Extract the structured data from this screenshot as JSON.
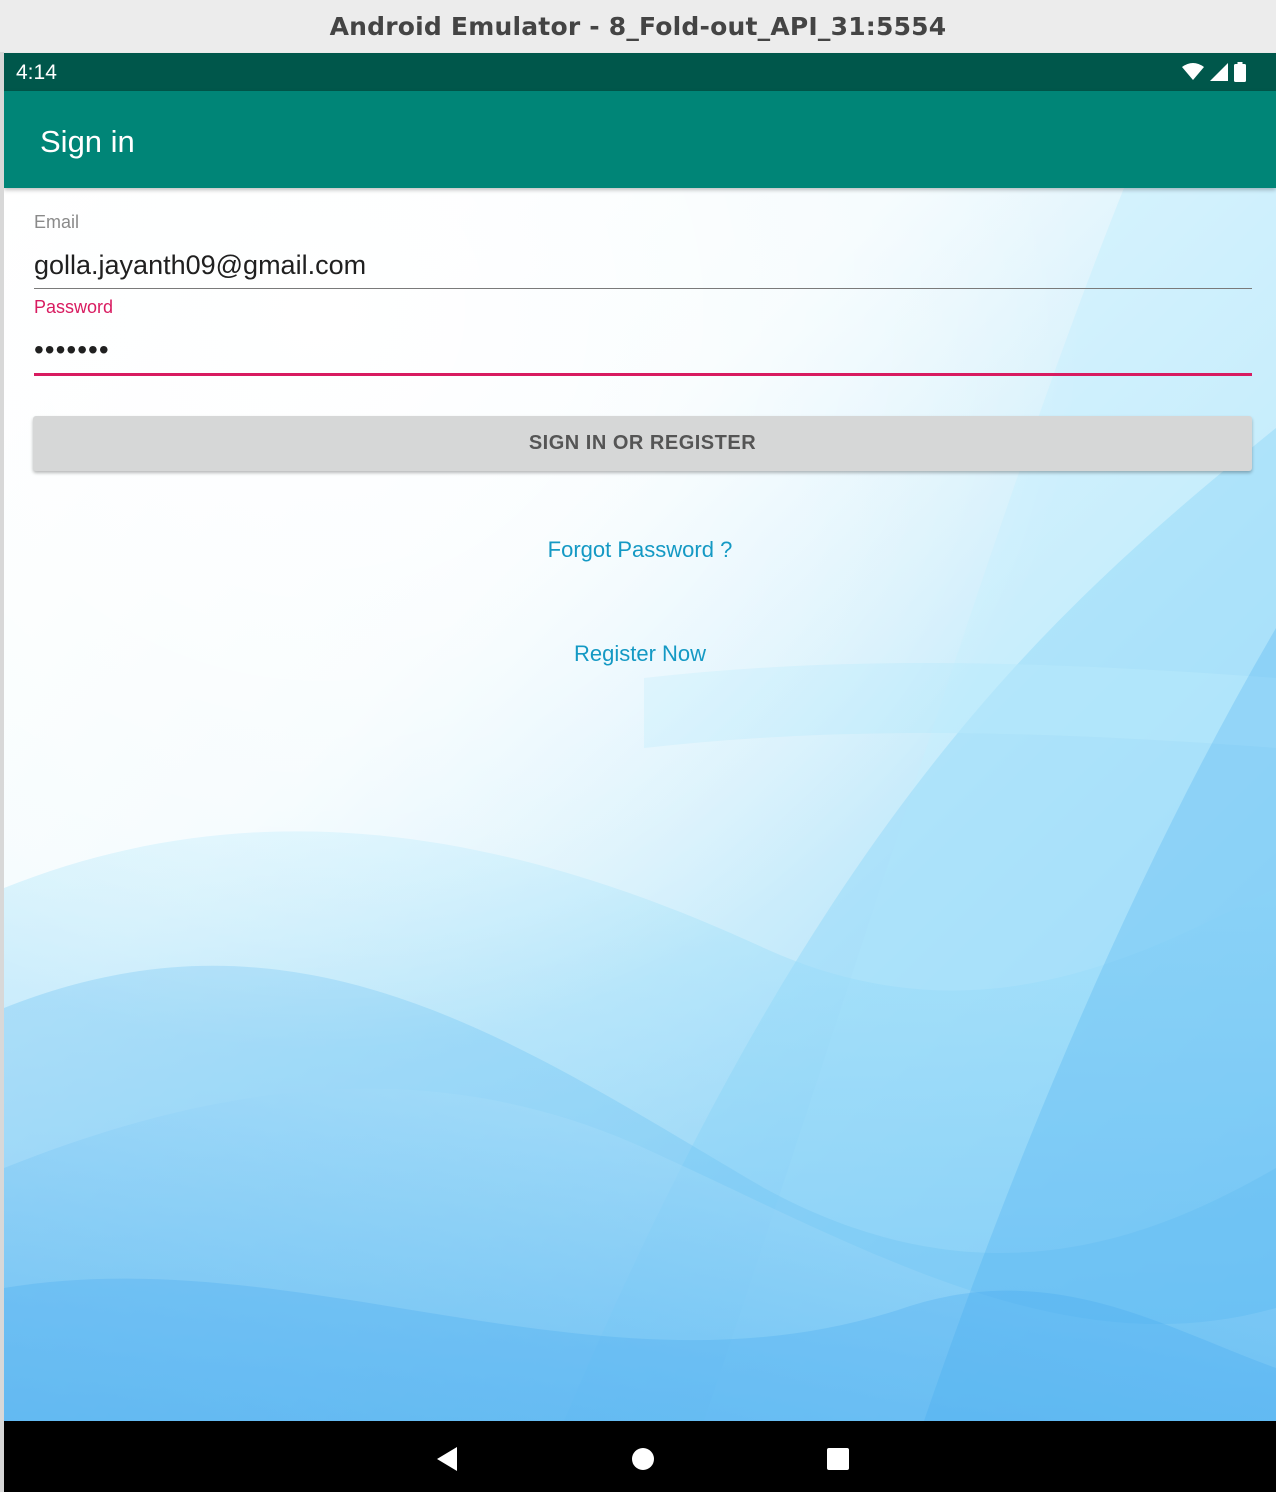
{
  "window": {
    "title": "Android Emulator - 8_Fold-out_API_31:5554"
  },
  "statusbar": {
    "time": "4:14",
    "icons": [
      "wifi-icon",
      "signal-icon",
      "battery-icon"
    ]
  },
  "appbar": {
    "title": "Sign in"
  },
  "form": {
    "email": {
      "label": "Email",
      "value": "golla.jayanth09@gmail.com"
    },
    "password": {
      "label": "Password",
      "value": "•••••••",
      "focused": true
    },
    "submit_label": "SIGN IN OR REGISTER",
    "forgot_password_label": "Forgot Password ?",
    "register_label": "Register Now"
  },
  "navbar": {
    "buttons": [
      "back-icon",
      "home-icon",
      "recents-icon"
    ]
  },
  "colors": {
    "statusbar": "#00574B",
    "appbar": "#008577",
    "accent": "#D81B60",
    "link": "#1499C4",
    "button": "#D6D7D7"
  }
}
